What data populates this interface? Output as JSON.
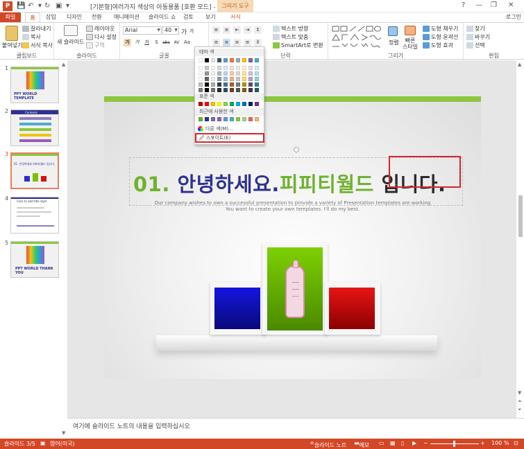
{
  "titlebar": {
    "title": "[기본형]여러가지 색상의 아동용품 [호환 모드] - PowerPoint",
    "tool_tab_head": "그리기 도구",
    "minimize": "—",
    "restore": "❐",
    "close": "✕",
    "help": "?"
  },
  "tabs": {
    "file": "파일",
    "home": "홈",
    "insert": "삽입",
    "design": "디자인",
    "transitions": "전환",
    "animations": "애니메이션",
    "slideshow": "슬라이드 쇼",
    "review": "검토",
    "view": "보기",
    "format": "서식",
    "login": "로그인"
  },
  "ribbon": {
    "clipboard": {
      "label": "클립보드",
      "paste": "붙여넣기",
      "cut": "잘라내기",
      "copy": "복사",
      "format_painter": "서식 복사"
    },
    "slides": {
      "label": "슬라이드",
      "new_slide": "새 슬라이드",
      "layout": "레이아웃",
      "reset": "다시 설정",
      "section": "구역"
    },
    "font": {
      "label": "글꼴",
      "font_name": "Arial",
      "font_size": "40",
      "grow": "가",
      "shrink": "가",
      "bold": "가",
      "italic": "가",
      "underline": "가",
      "shadow": "S",
      "strike": "abc",
      "spacing": "AV",
      "case": "Aa",
      "font_color": "가"
    },
    "paragraph": {
      "label": "단락",
      "text_direction": "텍스트 방향",
      "align_text": "텍스트 맞춤",
      "smartart": "SmartArt로 변환"
    },
    "drawing": {
      "label": "그리기",
      "arrange": "정렬",
      "quick_styles": "빠른 스타일",
      "fill": "도형 채우기",
      "outline": "도형 윤곽선",
      "effects": "도형 효과"
    },
    "editing": {
      "label": "편집",
      "find": "찾기",
      "replace": "바꾸기",
      "select": "선택"
    }
  },
  "colorpop": {
    "theme_colors": "테마 색",
    "standard_colors": "표준 색",
    "recent_colors": "최근에 사용한 색",
    "more_colors": "다른 색(M)...",
    "eyedropper": "스포이트(E)",
    "theme_top": [
      "#ffffff",
      "#000000",
      "#e7e6e6",
      "#44546a",
      "#5b9bd5",
      "#ed7d31",
      "#a5a5a5",
      "#ffc000",
      "#8064a2",
      "#4bacc6",
      "#f79646"
    ],
    "standard": [
      "#c00000",
      "#ff0000",
      "#ffc000",
      "#ffff00",
      "#92d050",
      "#00b050",
      "#00b0f0",
      "#0070c0",
      "#002060",
      "#7030a0"
    ],
    "recent": [
      "#6fb22e",
      "#2e3192",
      "#7e6bb8",
      "#9b59b6",
      "#5b9bd5",
      "#4bacc6",
      "#8dc63f",
      "#a9d18e",
      "#e06666",
      "#f6b26b"
    ]
  },
  "slides": [
    {
      "num": "1",
      "caption": "PPT WORLD TEMPLATE"
    },
    {
      "num": "2",
      "caption": "Contents"
    },
    {
      "num": "3",
      "caption": "01. 안녕하세요.피피티월드 입니다."
    },
    {
      "num": "4",
      "caption": "Click to add title style"
    },
    {
      "num": "5",
      "caption": "PPT WORLD THANK YOU"
    }
  ],
  "slide": {
    "title_num": "01.",
    "title_a": " 안녕하세요",
    "title_dot": ".",
    "title_b": "피피티월드 ",
    "title_c": "입니다.",
    "sub1": "Our company wishes to own a successful presentation to provide a variety of Presentation  templates are working",
    "sub2": "You want to create your own templates. I'll do my best."
  },
  "notes": {
    "placeholder": "여기에 슬라이드 노트의 내용을 입력하십시오"
  },
  "status": {
    "slide": "슬라이드 3/5",
    "language": "영어(미국)",
    "notes_btn": "슬라이드 노트",
    "comments": "메모",
    "zoom": "100 %"
  }
}
